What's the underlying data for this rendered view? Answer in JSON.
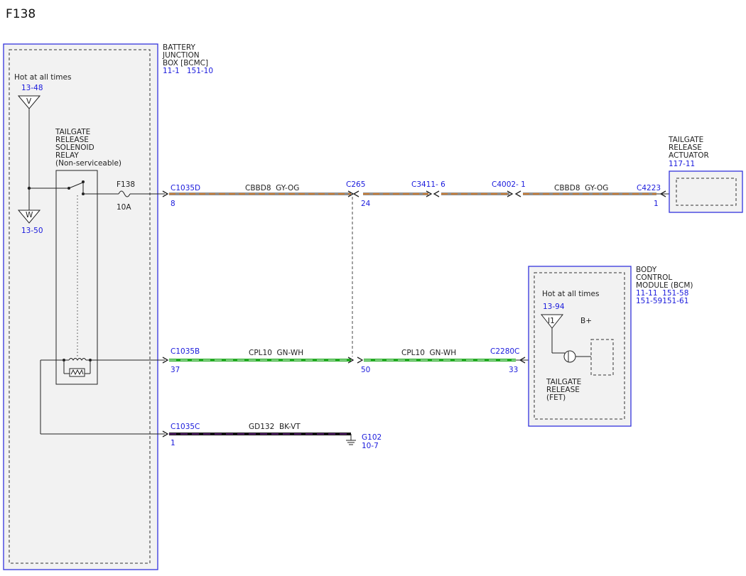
{
  "page": {
    "title": "F138"
  },
  "colors": {
    "blue_ref": "#1a1adc",
    "box_border": "#3333dd",
    "gy_og_base": "#8f8f8f",
    "gy_og_stripe": "#e07a1a",
    "gn_wh_base": "#22aa22",
    "gn_wh_stripe": "#ffffff",
    "bk_vt_base": "#111111",
    "bk_vt_stripe": "#9b30c8"
  },
  "battery_junction_box": {
    "name_lines": [
      "BATTERY",
      "JUNCTION",
      "BOX [BCMC]"
    ],
    "refs": "11-1   151-10",
    "hot_label": "Hot at all times",
    "hot_ref": "13-48",
    "top_terminal": "V",
    "bottom_terminal": "W",
    "bottom_ref": "13-50",
    "relay_lines": [
      "TAILGATE",
      "RELEASE",
      "SOLENOID",
      "RELAY",
      "(Non-serviceable)"
    ],
    "fuse_name": "F138",
    "fuse_rating": "10A"
  },
  "actuator": {
    "name_lines": [
      "TAILGATE",
      "RELEASE",
      "ACTUATOR"
    ],
    "ref": "117-11"
  },
  "bcm": {
    "name_lines": [
      "BODY",
      "CONTROL",
      "MODULE (BCM)"
    ],
    "ref_lines": [
      "11-11  151-58",
      "151-59151-61"
    ],
    "hot_label": "Hot at all times",
    "hot_ref": "13-94",
    "terminal": "I1",
    "bplus": "B+",
    "fet_lines": [
      "TAILGATE",
      "RELEASE",
      "(FET)"
    ]
  },
  "circuits": {
    "top": {
      "connector_left": "C1035D",
      "pin_left": "8",
      "circuit_a": "CBBD8  GY-OG",
      "splice_connector": "C265",
      "splice_pin": "24",
      "inline1": "C3411- 6",
      "inline2": "C4002- 1",
      "circuit_b": "CBBD8  GY-OG",
      "connector_right": "C4223",
      "pin_right": "1"
    },
    "middle": {
      "connector_left": "C1035B",
      "pin_left": "37",
      "circuit_a": "CPL10  GN-WH",
      "pin_mid": "50",
      "circuit_b": "CPL10  GN-WH",
      "connector_right": "C2280C",
      "pin_right": "33"
    },
    "bottom": {
      "connector_left": "C1035C",
      "pin_left": "1",
      "circuit": "GD132  BK-VT",
      "ground_name": "G102",
      "ground_ref": "10-7"
    }
  }
}
